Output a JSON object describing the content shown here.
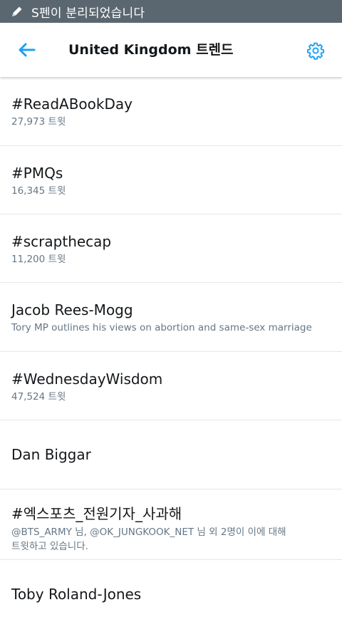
{
  "status_bar": {
    "text": "S펜이 분리되었습니다",
    "icon": "pen-icon",
    "bg_color": "#5b6770"
  },
  "header": {
    "title": "United Kingdom 트렌드",
    "back_icon": "back-arrow-icon",
    "settings_icon": "gear-icon",
    "accent_color": "#1da1f2"
  },
  "trends": [
    {
      "name": "#ReadABookDay",
      "sub": "27,973 트윗"
    },
    {
      "name": "#PMQs",
      "sub": "16,345 트윗"
    },
    {
      "name": "#scrapthecap",
      "sub": "11,200 트윗"
    },
    {
      "name": "Jacob Rees-Mogg",
      "sub": "Tory MP outlines his views on abortion and same-sex marriage"
    },
    {
      "name": "#WednesdayWisdom",
      "sub": "47,524 트윗"
    },
    {
      "name": "Dan Biggar",
      "sub": ""
    },
    {
      "name": "#엑스포츠_전원기자_사과해",
      "sub_line1": "@BTS_ARMY 님, @OK_JUNGKOOK_NET 님 외 2명이 이에 대해",
      "sub_line2": "트윗하고 있습니다."
    },
    {
      "name": "Toby Roland-Jones",
      "sub": ""
    }
  ]
}
